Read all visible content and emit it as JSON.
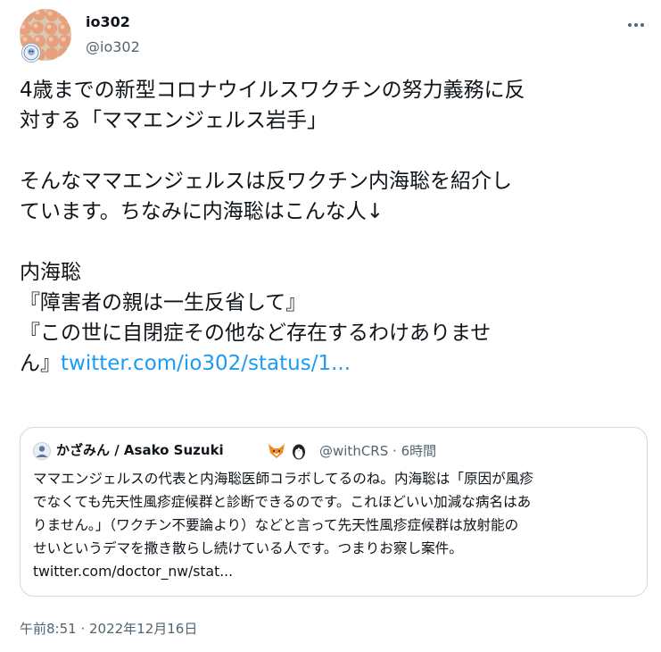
{
  "author": {
    "display_name": "io302",
    "handle": "@io302"
  },
  "tweet": {
    "lines": [
      "4歳までの新型コロナウイルスワクチンの努力義務に反",
      "対する「ママエンジェルス岩手」",
      "",
      "そんなママエンジェルスは反ワクチン内海聡を紹介し",
      "ています。ちなみに内海聡はこんな人↓",
      "",
      "内海聡",
      "『障害者の親は一生反省して』",
      "『この世に自閉症その他など存在するわけありませ"
    ],
    "last_line_prefix": "ん』",
    "link_text": "twitter.com/io302/status/1..."
  },
  "quote": {
    "display_name": "かざみん / Asako Suzuki",
    "handle": "@withCRS",
    "separator": "·",
    "time": "6時間",
    "lines": [
      "ママエンジェルスの代表と内海聡医師コラボしてるのね。内海聡は「原因が風疹",
      "でなくても先天性風疹症候群と診断できるのです。これほどいい加減な病名はあ",
      "りません。」（ワクチン不要論より）などと言って先天性風疹症候群は放射能の",
      "せいというデマを撒き散らし続けている人です。つまりお察し案件。"
    ],
    "link_text": "twitter.com/doctor_nw/stat..."
  },
  "timestamp": "午前8:51 · 2022年12月16日",
  "icons": {
    "more": "more-horizontal-icon",
    "quote_emoji_1": "fox-icon",
    "quote_emoji_2": "penguin-icon"
  },
  "colors": {
    "link": "#1d9bf0",
    "secondary_text": "#536471",
    "border": "#cfd9de"
  }
}
